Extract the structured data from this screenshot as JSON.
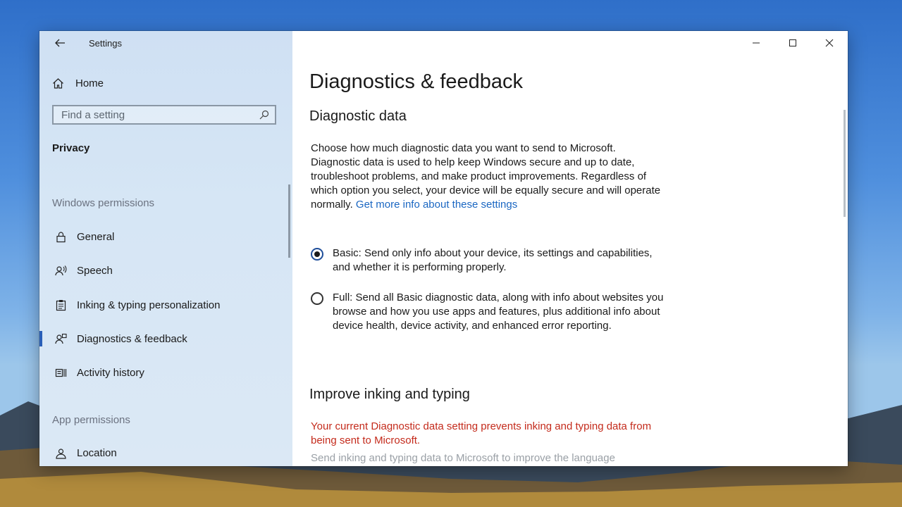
{
  "window": {
    "title": "Settings"
  },
  "sidebar": {
    "home_label": "Home",
    "search_placeholder": "Find a setting",
    "section": "Privacy",
    "groups": {
      "windows_permissions": "Windows permissions",
      "app_permissions": "App permissions"
    },
    "items": [
      {
        "label": "General",
        "icon": "lock-icon"
      },
      {
        "label": "Speech",
        "icon": "speech-icon"
      },
      {
        "label": "Inking & typing personalization",
        "icon": "inking-icon"
      },
      {
        "label": "Diagnostics & feedback",
        "icon": "diagnostics-icon",
        "selected": true
      },
      {
        "label": "Activity history",
        "icon": "activity-icon"
      },
      {
        "label": "Location",
        "icon": "location-icon"
      }
    ]
  },
  "main": {
    "title": "Diagnostics & feedback",
    "diagnostic": {
      "heading": "Diagnostic data",
      "description": "Choose how much diagnostic data you want to send to Microsoft. Diagnostic data is used to help keep Windows secure and up to date, troubleshoot problems, and make product improvements. Regardless of which option you select, your device will be equally secure and will operate normally.",
      "link": "Get more info about these settings",
      "options": [
        {
          "label": "Basic: Send only info about your device, its settings and capabilities, and whether it is performing properly.",
          "selected": true
        },
        {
          "label": "Full: Send all Basic diagnostic data, along with info about websites you browse and how you use apps and features, plus additional info about device health, device activity, and enhanced error reporting.",
          "selected": false
        }
      ]
    },
    "inking": {
      "heading": "Improve inking and typing",
      "warning": "Your current Diagnostic data setting prevents inking and typing data from being sent to Microsoft.",
      "description": "Send inking and typing data to Microsoft to improve the language"
    }
  },
  "colors": {
    "accent": "#2a5fb8",
    "link": "#1b67c2",
    "warning": "#c42b1c"
  }
}
